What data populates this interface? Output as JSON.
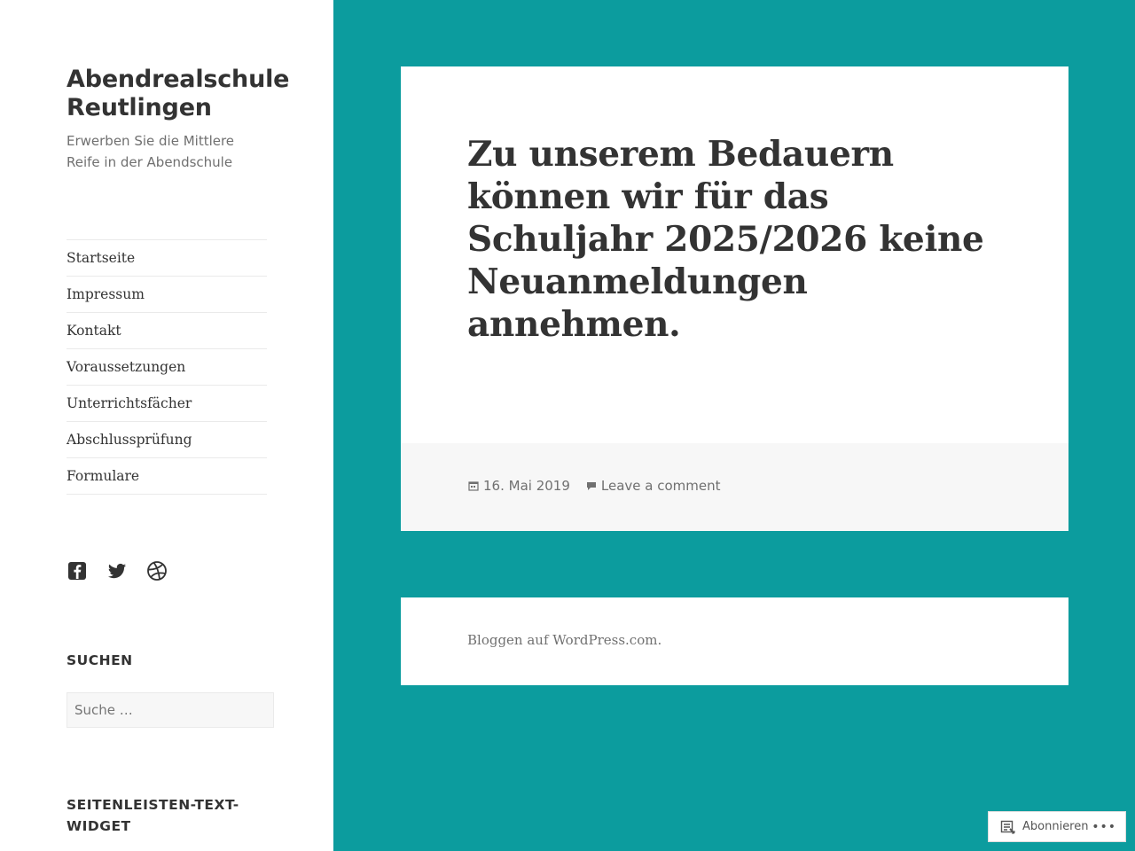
{
  "site": {
    "title": "Abendrealschule Reutlingen",
    "description": "Erwerben Sie die Mittlere Reife in der Abendschule"
  },
  "nav": {
    "items": [
      {
        "label": "Startseite"
      },
      {
        "label": "Impressum"
      },
      {
        "label": "Kontakt"
      },
      {
        "label": "Voraussetzungen"
      },
      {
        "label": "Unterrichtsfächer"
      },
      {
        "label": "Abschlussprüfung"
      },
      {
        "label": "Formulare"
      }
    ]
  },
  "social": {
    "icons": [
      "facebook-icon",
      "twitter-icon",
      "dribbble-icon"
    ]
  },
  "search": {
    "title": "SUCHEN",
    "placeholder": "Suche …"
  },
  "text_widget": {
    "title": "SEITENLEISTEN-TEXT-WIDGET"
  },
  "post": {
    "title": "Zu unserem Bedauern können wir für das Schuljahr 2025/2026 keine Neuanmeldungen annehmen.",
    "date": "16. Mai 2019",
    "comment_link": "Leave a comment"
  },
  "footer": {
    "credit": "Bloggen auf WordPress.com."
  },
  "subscribe": {
    "label": "Abonnieren",
    "more": "•••"
  },
  "colors": {
    "background": "#0c9c9e",
    "sidebar": "#ffffff",
    "text": "#333333",
    "muted": "#707070"
  }
}
